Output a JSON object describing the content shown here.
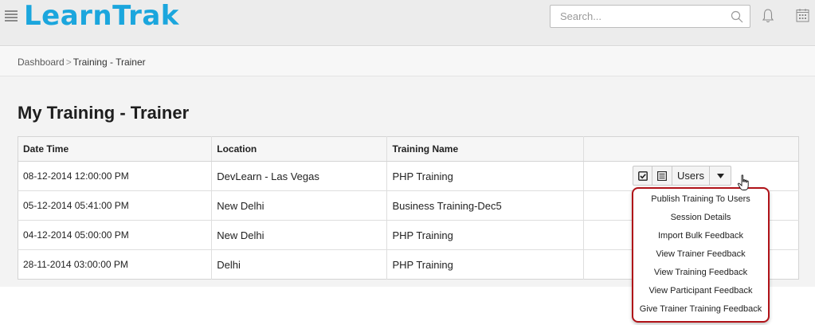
{
  "header": {
    "app_name": "LearnTrak",
    "search_placeholder": "Search..."
  },
  "breadcrumb": {
    "items": [
      "Dashboard",
      "Training - Trainer"
    ]
  },
  "page": {
    "title": "My Training - Trainer"
  },
  "table": {
    "columns": [
      "Date Time",
      "Location",
      "Training Name",
      ""
    ],
    "rows": [
      [
        "08-12-2014 12:00:00 PM",
        "DevLearn - Las Vegas",
        "PHP Training"
      ],
      [
        "05-12-2014 05:41:00 PM",
        "New Delhi",
        "Business Training-Dec5"
      ],
      [
        "04-12-2014 05:00:00 PM",
        "New Delhi",
        "PHP Training"
      ],
      [
        "28-11-2014 03:00:00 PM",
        "Delhi",
        "PHP Training"
      ]
    ]
  },
  "actions": {
    "users_label": "Users",
    "menu_items": [
      "Publish Training To Users",
      "Session Details",
      "Import Bulk Feedback",
      "View Trainer Feedback",
      "View Training Feedback",
      "View Participant Feedback",
      "Give Trainer Training Feedback"
    ]
  },
  "colors": {
    "brand": "#1ba6dd",
    "highlight_outline": "#b01218",
    "topbar": "#ececec"
  },
  "icons": [
    "menu-icon",
    "search-icon",
    "bell-icon",
    "calendar-icon",
    "checklist-icon",
    "list-icon",
    "caret-down-icon",
    "hand-cursor-icon"
  ]
}
